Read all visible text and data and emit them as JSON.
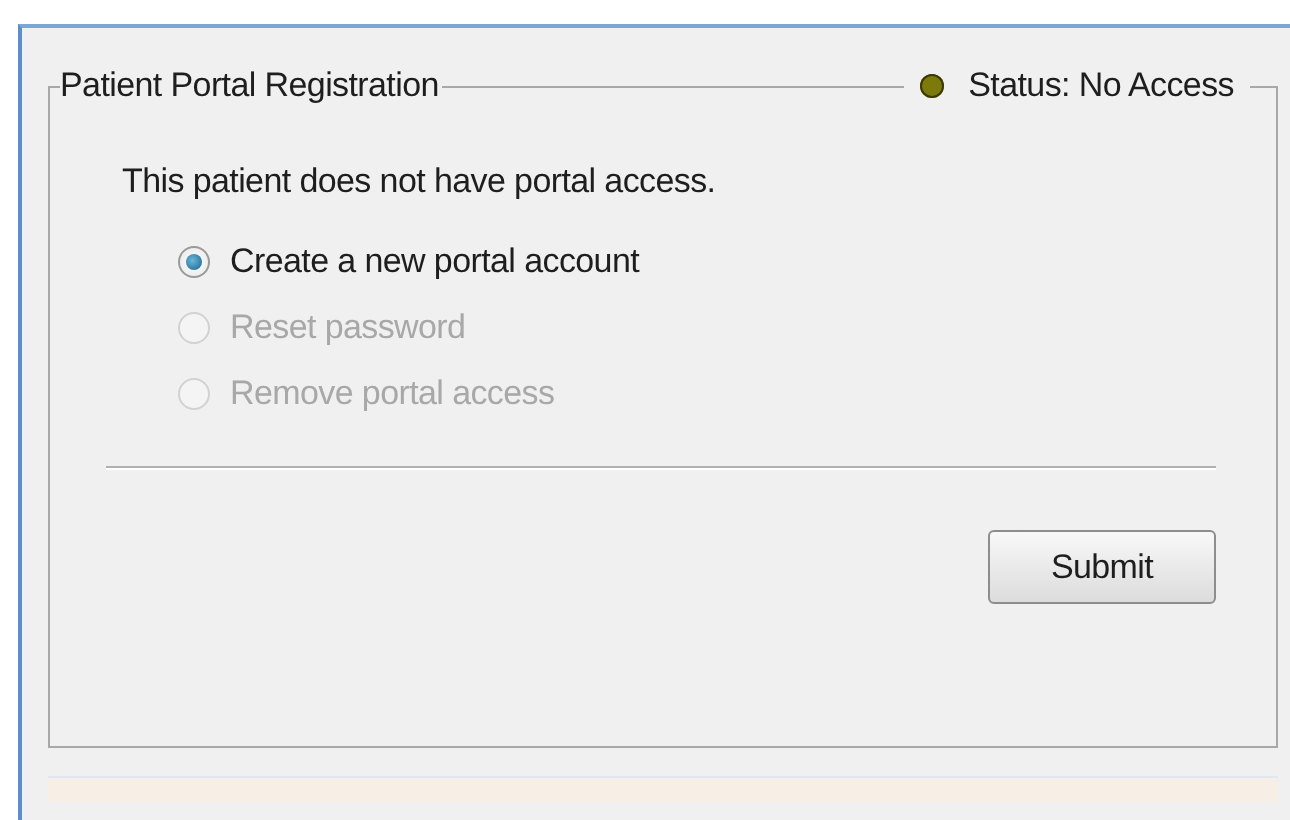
{
  "group": {
    "title": "Patient Portal Registration",
    "status": {
      "label": "Status: No Access",
      "color": "#7d7a0c"
    }
  },
  "description": "This patient does not have portal access.",
  "options": [
    {
      "label": "Create a new portal account",
      "selected": true,
      "disabled": false
    },
    {
      "label": "Reset password",
      "selected": false,
      "disabled": true
    },
    {
      "label": "Remove portal access",
      "selected": false,
      "disabled": true
    }
  ],
  "buttons": [
    "Submit"
  ]
}
